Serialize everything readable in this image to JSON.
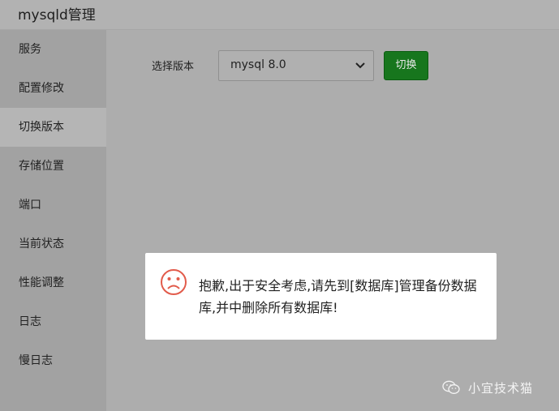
{
  "window": {
    "title": "mysqld管理"
  },
  "sidebar": {
    "items": [
      {
        "label": "服务"
      },
      {
        "label": "配置修改"
      },
      {
        "label": "切换版本"
      },
      {
        "label": "存储位置"
      },
      {
        "label": "端口"
      },
      {
        "label": "当前状态"
      },
      {
        "label": "性能调整"
      },
      {
        "label": "日志"
      },
      {
        "label": "慢日志"
      }
    ],
    "active_index": 2
  },
  "main": {
    "version_label": "选择版本",
    "version_select": {
      "selected": "mysql 8.0"
    },
    "switch_button": "切换"
  },
  "dialog": {
    "icon": "sad-face-icon",
    "message": "抱歉,出于安全考虑,请先到[数据库]管理备份数据库,并中删除所有数据库!",
    "icon_color": "#e25b4b"
  },
  "watermark": {
    "icon": "wechat-icon",
    "text": "小宜技术猫"
  },
  "colors": {
    "overlay_bg": "#adadad",
    "sidebar_bg": "#a2a2a2",
    "active_item_bg": "#b5b5b5",
    "accent_green": "#17761d",
    "dialog_bg": "#ffffff"
  }
}
